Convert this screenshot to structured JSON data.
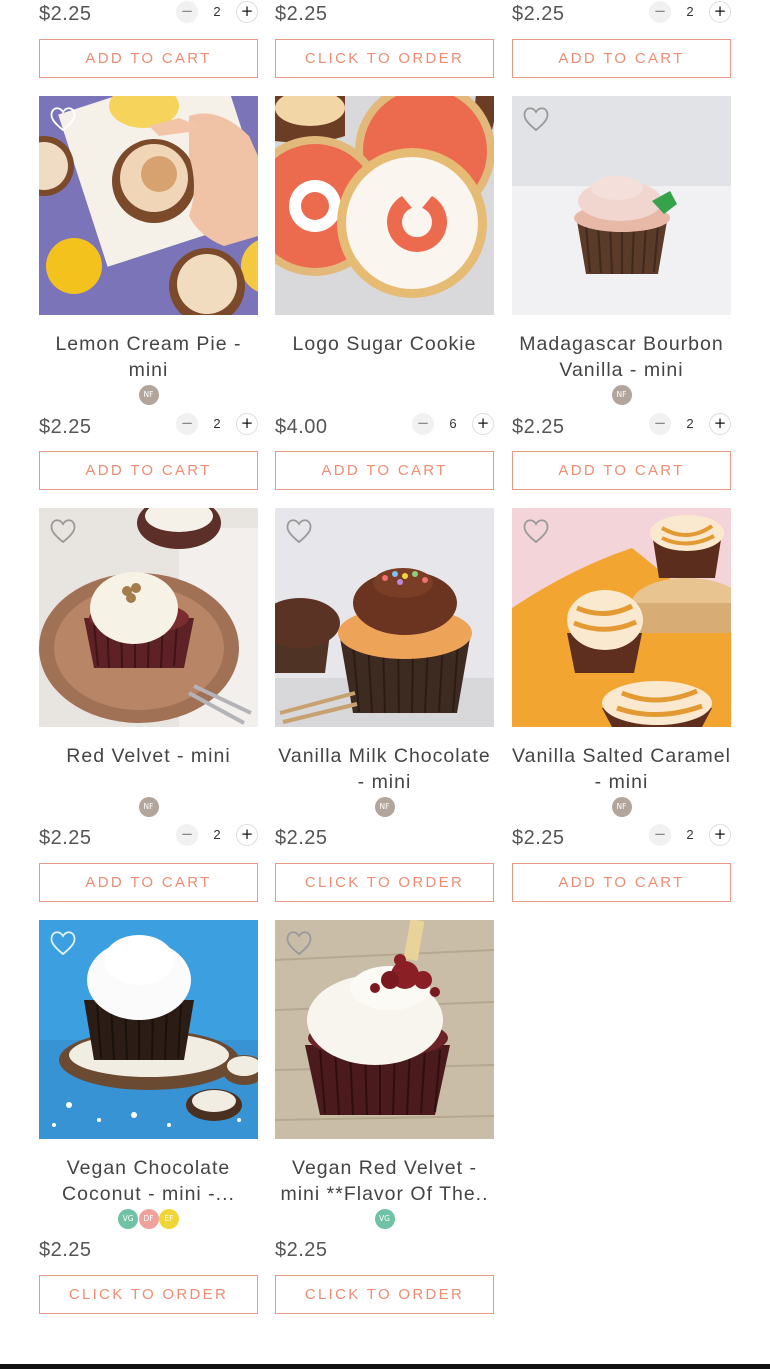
{
  "labels": {
    "add_to_cart": "ADD TO CART",
    "click_to_order": "CLICK TO ORDER"
  },
  "colors": {
    "accent": "#ef8d73",
    "nf_badge": "#b2a59b",
    "vg_badge": "#6fc2a3",
    "df_badge": "#f0a19a",
    "ef_badge": "#f1d536"
  },
  "products": [
    {
      "name": "",
      "badges": [],
      "price": "$2.25",
      "qty": "2",
      "cta": "ADD TO CART",
      "image": "cupcake-image"
    },
    {
      "name": "",
      "badges": [],
      "price": "$2.25",
      "qty": null,
      "cta": "CLICK TO ORDER",
      "image": "cupcake-image"
    },
    {
      "name": "",
      "badges": [],
      "price": "$2.25",
      "qty": "2",
      "cta": "ADD TO CART",
      "image": "cupcake-image"
    },
    {
      "name": "Lemon Cream Pie - mini",
      "badges": [
        "NF"
      ],
      "price": "$2.25",
      "qty": "2",
      "cta": "ADD TO CART",
      "image": "lemon-cream-pie-cupcake"
    },
    {
      "name": "Logo Sugar Cookie",
      "badges": [],
      "price": "$4.00",
      "qty": "6",
      "cta": "ADD TO CART",
      "image": "logo-sugar-cookie"
    },
    {
      "name": "Madagascar Bourbon Vanilla - mini",
      "badges": [
        "NF"
      ],
      "price": "$2.25",
      "qty": "2",
      "cta": "ADD TO CART",
      "image": "vanilla-cupcake"
    },
    {
      "name": "Red Velvet - mini",
      "badges": [
        "NF"
      ],
      "price": "$2.25",
      "qty": "2",
      "cta": "ADD TO CART",
      "image": "red-velvet-cupcake"
    },
    {
      "name": "Vanilla Milk Chocolate - mini",
      "badges": [
        "NF"
      ],
      "price": "$2.25",
      "qty": null,
      "cta": "CLICK TO ORDER",
      "image": "chocolate-frosting-cupcake"
    },
    {
      "name": "Vanilla Salted Caramel - mini",
      "badges": [
        "NF"
      ],
      "price": "$2.25",
      "qty": "2",
      "cta": "ADD TO CART",
      "image": "salted-caramel-cupcakes"
    },
    {
      "name": "Vegan Chocolate Coconut - mini -...",
      "badges": [
        "VG",
        "DF",
        "EF"
      ],
      "price": "$2.25",
      "qty": null,
      "cta": "CLICK TO ORDER",
      "image": "coconut-cupcake"
    },
    {
      "name": "Vegan Red Velvet - mini **Flavor Of The..",
      "badges": [
        "VG"
      ],
      "price": "$2.25",
      "qty": null,
      "cta": "CLICK TO ORDER",
      "image": "vegan-red-velvet-cupcake"
    }
  ]
}
